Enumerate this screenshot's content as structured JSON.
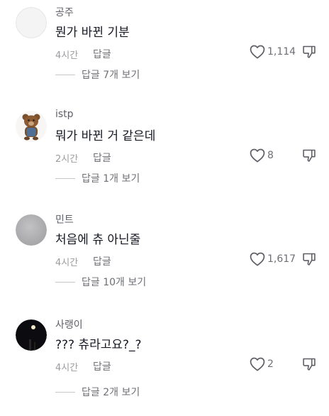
{
  "comments": [
    {
      "username": "공주",
      "text": "뭔가 바뀐 기분",
      "time": "4시간",
      "reply_label": "답글",
      "likes": "1,114",
      "view_replies": "답글 7개 보기",
      "avatar": "blank-avatar"
    },
    {
      "username": "istp",
      "text": "뭐가 바뀐 거 같은데",
      "time": "2시간",
      "reply_label": "답글",
      "likes": "8",
      "view_replies": "답글 1개 보기",
      "avatar": "teddy-bear-avatar"
    },
    {
      "username": "민트",
      "text": "처음에 츄 아닌줄",
      "time": "4시간",
      "reply_label": "답글",
      "likes": "1,617",
      "view_replies": "답글 10개 보기",
      "avatar": "gray-avatar"
    },
    {
      "username": "사랭이",
      "text": "??? 츄라고요?_?",
      "time": "4시간",
      "reply_label": "답글",
      "likes": "2",
      "view_replies": "답글 2개 보기",
      "avatar": "dark-night-avatar"
    }
  ],
  "icons": {
    "like": "heart-outline-icon",
    "dislike": "thumbs-down-outline-icon"
  },
  "colors": {
    "text_primary": "#161823",
    "text_secondary": "#6e6f75",
    "text_muted": "#9c9ca0",
    "divider": "#c7c7cb"
  }
}
